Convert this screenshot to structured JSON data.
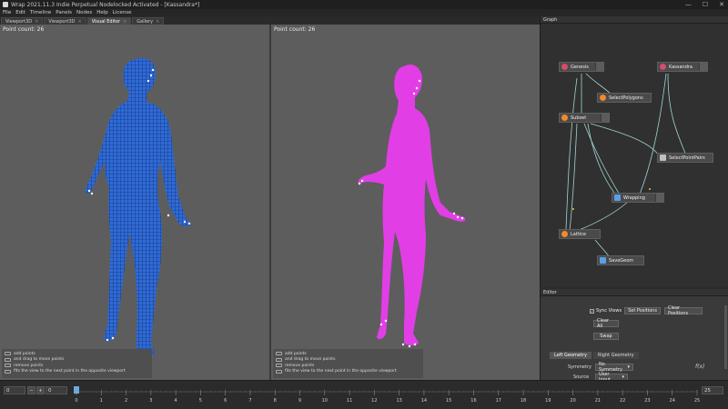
{
  "window": {
    "title": "Wrap 2021.11.3  Indie Perpetual Nodelocked Activated - [Kassandra*]",
    "controls": [
      "—",
      "☐",
      "✕"
    ]
  },
  "menu": [
    "File",
    "Edit",
    "Timeline",
    "Panels",
    "Nodes",
    "Help",
    "License"
  ],
  "tabs": [
    {
      "label": "Viewport3D",
      "active": false
    },
    {
      "label": "Viewport3D",
      "active": false
    },
    {
      "label": "Visual Editor",
      "active": true
    },
    {
      "label": "Gallery",
      "active": false
    }
  ],
  "viewport_left": {
    "point_count": "Point count: 26",
    "mesh_color": "#2f6ad8",
    "hints": [
      "add points",
      "and drag to move points",
      "remove points",
      "fits the view to the next point in the opposite viewport"
    ]
  },
  "viewport_right": {
    "point_count": "Point count: 26",
    "mesh_color": "#e23ee6",
    "hints": [
      "add points",
      "and drag to move points",
      "remove points",
      "fits the view to the next point in the opposite viewport"
    ]
  },
  "graph": {
    "title": "Graph",
    "nodes": [
      {
        "id": "genesis",
        "label": "Genesis",
        "icon_color": "#d94b6e"
      },
      {
        "id": "kassandra",
        "label": "Kassandra",
        "icon_color": "#d94b6e"
      },
      {
        "id": "selectpolygons",
        "label": "SelectPolygons",
        "icon_color": "#f08a2a"
      },
      {
        "id": "subset",
        "label": "Subset",
        "icon_color": "#f08a2a"
      },
      {
        "id": "selectpointpairs",
        "label": "SelectPointPairs",
        "icon_color": "#c0c0c0"
      },
      {
        "id": "wrapping",
        "label": "Wrapping",
        "icon_color": "#5aa0e6"
      },
      {
        "id": "lattice",
        "label": "Lattice",
        "icon_color": "#f08a2a"
      },
      {
        "id": "savegeom",
        "label": "SaveGeom",
        "icon_color": "#5aa0e6"
      }
    ]
  },
  "editor": {
    "title": "Editor",
    "sync_views_label": "Sync Views",
    "sync_views_checked": true,
    "set_positions": "Set Positions",
    "clear_positions": "Clear Positions",
    "clear_all": "Clear All",
    "swap": "Swap",
    "tabs": [
      {
        "label": "Left Geometry",
        "active": true
      },
      {
        "label": "Right Geometry",
        "active": false
      }
    ],
    "symmetry_label": "Symmetry",
    "symmetry_value": "No Symmetry",
    "source_label": "Source",
    "source_value": "User Input",
    "fx_icon": "f(x)"
  },
  "timeline": {
    "start": "0",
    "current": "0",
    "end": "25",
    "ticks": [
      "0",
      "1",
      "2",
      "3",
      "4",
      "5",
      "6",
      "7",
      "8",
      "9",
      "10",
      "11",
      "12",
      "13",
      "14",
      "15",
      "16",
      "17",
      "18",
      "19",
      "20",
      "21",
      "22",
      "23",
      "24",
      "25"
    ]
  }
}
